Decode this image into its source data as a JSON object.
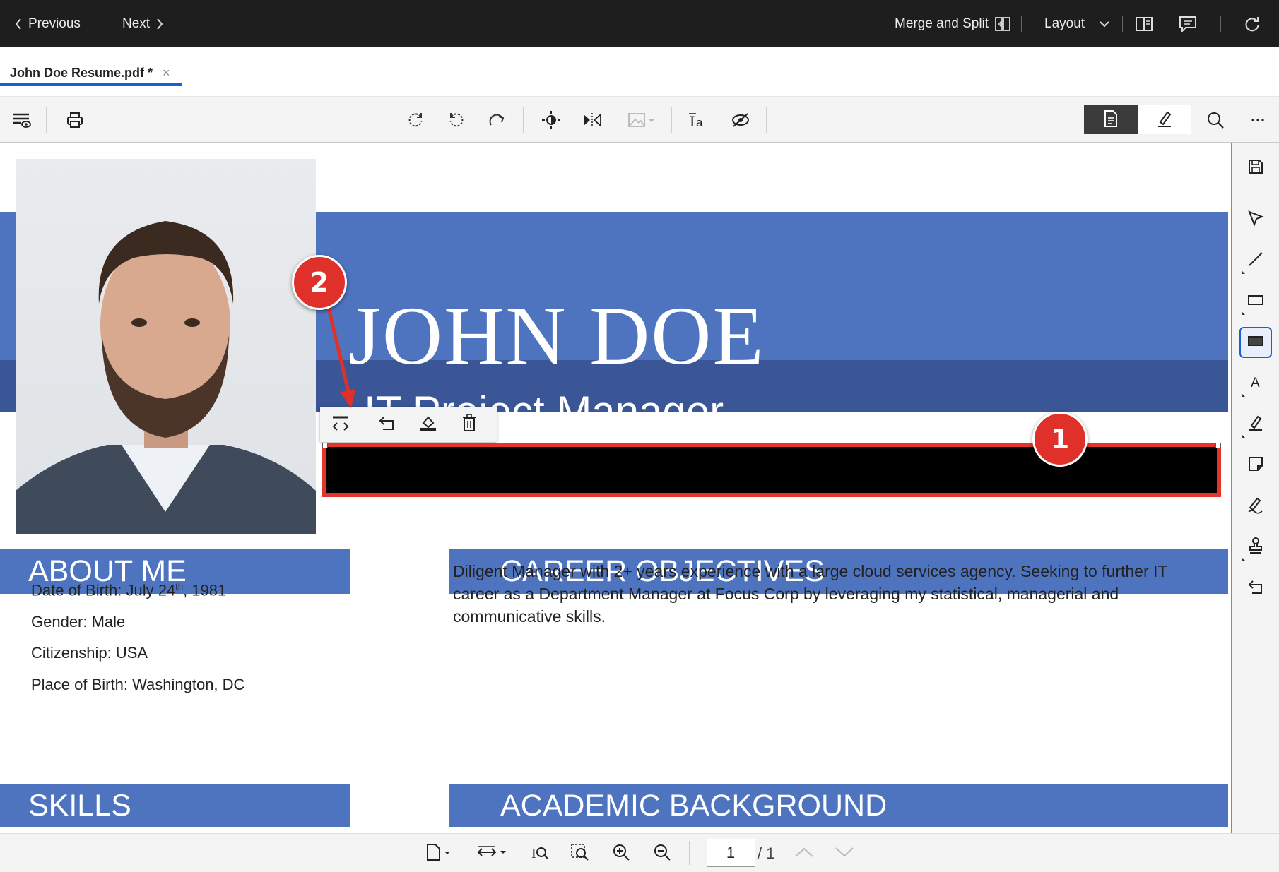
{
  "topbar": {
    "previous_label": "Previous",
    "next_label": "Next",
    "merge_split_label": "Merge and Split",
    "layout_label": "Layout"
  },
  "tab": {
    "title": "John Doe Resume.pdf *",
    "close_glyph": "×"
  },
  "resume": {
    "name": "JOHN DOE",
    "job_title": "IT Project Manager",
    "about_heading": "ABOUT ME",
    "about_items": [
      {
        "prefix": "Date of Birth: July 24",
        "sup": "th",
        "suffix": ", 1981"
      },
      {
        "text": "Gender: Male"
      },
      {
        "text": "Citizenship: USA"
      },
      {
        "text": "Place of Birth: Washington, DC"
      }
    ],
    "career_heading": "CAREER OBJECTIVES",
    "career_text": "Diligent Manager with 2+ years experience with a large cloud services agency. Seeking to further IT career as a Department Manager at Focus Corp  by leveraging my statistical, managerial and communicative skills.",
    "skills_heading": "SKILLS",
    "academic_heading": "ACADEMIC BACKGROUND"
  },
  "callouts": {
    "first": "1",
    "second": "2"
  },
  "pagination": {
    "current_page": "1",
    "total_pages": "/ 1"
  },
  "colors": {
    "band_blue": "#4e74c0",
    "band_dark_blue": "#3a5696",
    "callout_red": "#e0302a",
    "tab_underline": "#1a5fd6",
    "topbar_bg": "#1e1e1e"
  },
  "icons": {
    "toolbar": [
      "view-settings-icon",
      "print-icon",
      "rotate-clockwise-icon",
      "rotate-counterclockwise-icon",
      "redo-icon",
      "brightness-icon",
      "flip-icon",
      "image-icon",
      "text-recognition-icon",
      "hide-icon",
      "page-mode-icon",
      "annotate-mode-icon",
      "search-icon",
      "more-icon"
    ],
    "right_rail": [
      "save-icon",
      "select-arrow-icon",
      "line-icon",
      "rectangle-icon",
      "redact-area-icon",
      "text-icon",
      "highlighter-icon",
      "sticky-note-icon",
      "signature-icon",
      "stamp-icon",
      "undo-icon"
    ],
    "floating": [
      "apply-redaction-icon",
      "undo-icon",
      "fill-color-icon",
      "delete-icon"
    ]
  }
}
